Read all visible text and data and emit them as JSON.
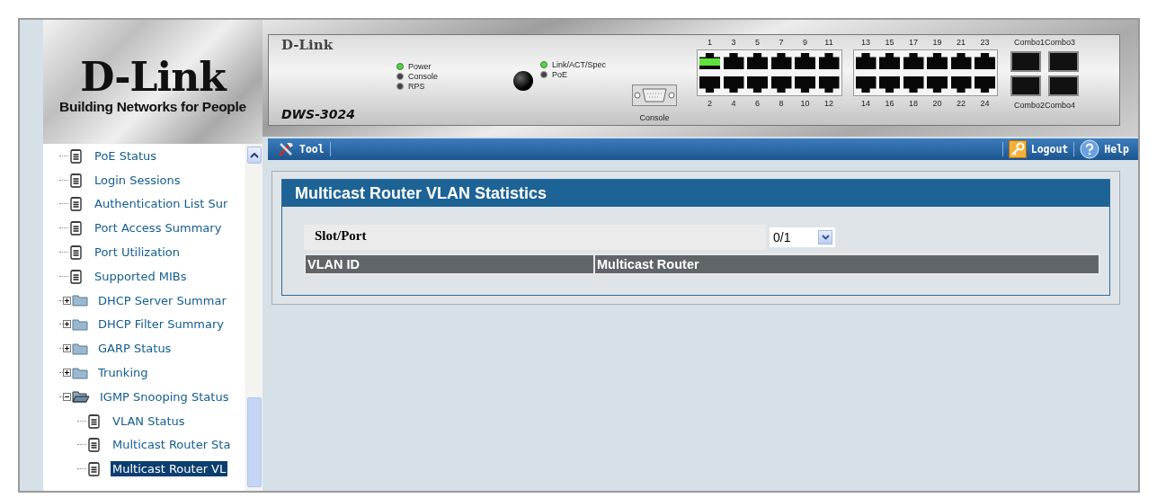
{
  "logo": {
    "brand": "D-Link",
    "tagline": "Building Networks for People"
  },
  "device": {
    "brand": "D-Link",
    "model": "DWS-3024",
    "console_label": "Console",
    "status_leds": [
      {
        "label": "Power",
        "on": true
      },
      {
        "label": "Console",
        "on": false
      },
      {
        "label": "RPS",
        "on": false
      }
    ],
    "mode_leds": [
      {
        "label": "Link/ACT/Spec",
        "on": true
      },
      {
        "label": "PoE",
        "on": false
      }
    ],
    "ports": [
      {
        "label": "1",
        "link": true
      },
      {
        "label": "2",
        "link": false
      },
      {
        "label": "3",
        "link": false
      },
      {
        "label": "4",
        "link": false
      },
      {
        "label": "5",
        "link": false
      },
      {
        "label": "6",
        "link": false
      },
      {
        "label": "7",
        "link": false
      },
      {
        "label": "8",
        "link": false
      },
      {
        "label": "9",
        "link": false
      },
      {
        "label": "10",
        "link": false
      },
      {
        "label": "11",
        "link": false
      },
      {
        "label": "12",
        "link": false
      },
      {
        "label": "13",
        "link": false
      },
      {
        "label": "14",
        "link": false
      },
      {
        "label": "15",
        "link": false
      },
      {
        "label": "16",
        "link": false
      },
      {
        "label": "17",
        "link": false
      },
      {
        "label": "18",
        "link": false
      },
      {
        "label": "19",
        "link": false
      },
      {
        "label": "20",
        "link": false
      },
      {
        "label": "21",
        "link": false
      },
      {
        "label": "22",
        "link": false
      },
      {
        "label": "23",
        "link": false
      },
      {
        "label": "24",
        "link": false
      }
    ],
    "combo_ports": [
      {
        "label": "Combo1",
        "link": false
      },
      {
        "label": "Combo2",
        "link": false
      },
      {
        "label": "Combo3",
        "link": false
      },
      {
        "label": "Combo4",
        "link": false
      }
    ]
  },
  "tree": [
    {
      "label": "PoE Status",
      "kind": "page",
      "selected": false
    },
    {
      "label": "Login Sessions",
      "kind": "page",
      "selected": false
    },
    {
      "label": "Authentication List Sur",
      "kind": "page",
      "selected": false
    },
    {
      "label": "Port Access Summary",
      "kind": "page",
      "selected": false
    },
    {
      "label": "Port Utilization",
      "kind": "page",
      "selected": false
    },
    {
      "label": "Supported MIBs",
      "kind": "page",
      "selected": false
    },
    {
      "label": "DHCP Server Summar",
      "kind": "folder",
      "expanded": false,
      "selected": false
    },
    {
      "label": "DHCP Filter Summary",
      "kind": "folder",
      "expanded": false,
      "selected": false
    },
    {
      "label": "GARP Status",
      "kind": "folder",
      "expanded": false,
      "selected": false
    },
    {
      "label": "Trunking",
      "kind": "folder",
      "expanded": false,
      "selected": false
    },
    {
      "label": "IGMP Snooping Status",
      "kind": "folder",
      "expanded": true,
      "selected": false,
      "children": [
        {
          "label": "VLAN Status",
          "kind": "page",
          "selected": false
        },
        {
          "label": "Multicast Router Sta",
          "kind": "page",
          "selected": false
        },
        {
          "label": "Multicast Router VL",
          "kind": "page",
          "selected": true
        }
      ]
    }
  ],
  "toolbar": {
    "tool": "Tool",
    "logout": "Logout",
    "help": "Help"
  },
  "panel": {
    "title": "Multicast Router VLAN Statistics",
    "field_label": "Slot/Port",
    "slot_port": "0/1",
    "columns": [
      "VLAN ID",
      "Multicast Router"
    ]
  }
}
